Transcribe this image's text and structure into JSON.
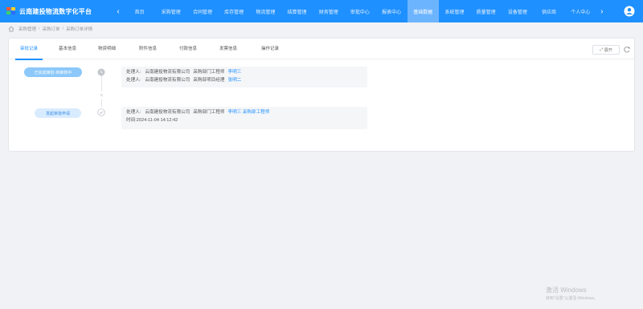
{
  "app": {
    "title": "云南建投物流数字化平台",
    "nav_items": [
      "首页",
      "采购管理",
      "合同管理",
      "库存管理",
      "物流管理",
      "结算管理",
      "财务管理",
      "审批中心",
      "报表中心",
      "基础数据",
      "系统管理",
      "质量管理",
      "设备管理",
      "供应商",
      "个人中心"
    ],
    "active_nav_index": 9
  },
  "breadcrumb": [
    "采购管理",
    "采购订单",
    "采购订单详情"
  ],
  "tabs": {
    "items": [
      "审批记录",
      "基本信息",
      "物资明细",
      "附件信息",
      "付款信息",
      "发票信息",
      "操作记录"
    ],
    "active_index": 0,
    "expand_label": "展开"
  },
  "timeline": [
    {
      "status": "已完成审批·待审核中",
      "lines": [
        {
          "label": "处理人:",
          "org": "云南建投物流有限公司",
          "role": "采购部门工程师",
          "name": "李明三"
        },
        {
          "label": "处理人:",
          "org": "云南建投物流有限公司",
          "role": "采购部项目经理",
          "name": "张明二"
        }
      ]
    },
    {
      "status": "发起审批申请",
      "lines": [
        {
          "label": "处理人:",
          "org": "云南建投物流有限公司",
          "role": "采购部门工程师",
          "name": "李明三 采购部工程师"
        }
      ],
      "time_label": "时间:",
      "time": "2024-11-04 14:12:42"
    }
  ],
  "watermark": {
    "title": "激活 Windows",
    "subtitle": "转到“设置”以激活 Windows。"
  },
  "colors": {
    "primary": "#1e90ff",
    "active_nav": "#6db4ff",
    "page_bg": "#f0f2f5"
  }
}
